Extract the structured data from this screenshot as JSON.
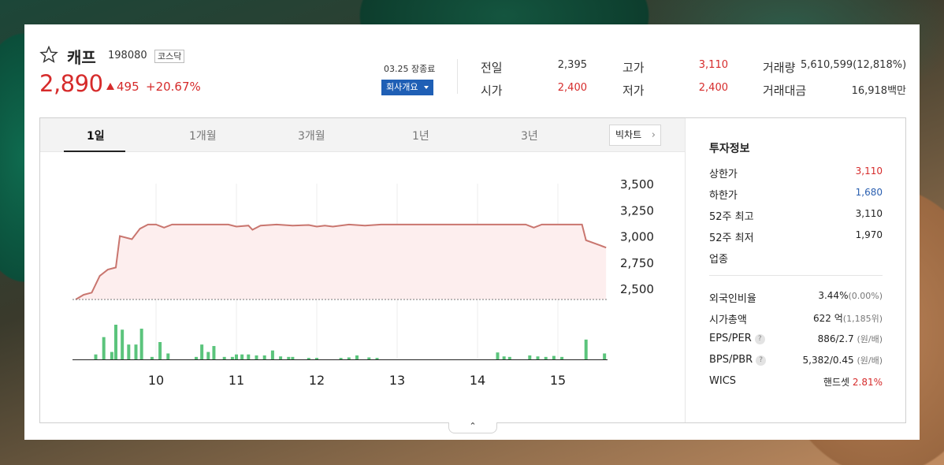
{
  "stock": {
    "name": "캐프",
    "code": "198080",
    "market": "코스닥",
    "price": "2,890",
    "change": "495",
    "change_rate": "+20.67%",
    "close_time": "03.25 장종료",
    "company_button": "회사개요"
  },
  "quotes": {
    "prev_close_label": "전일",
    "prev_close": "2,395",
    "open_label": "시가",
    "open": "2,400",
    "high_label": "고가",
    "high": "3,110",
    "low_label": "저가",
    "low": "2,400",
    "volume_label": "거래량",
    "volume": "5,610,599(12,818%)",
    "amount_label": "거래대금",
    "amount": "16,918백만"
  },
  "tabs": [
    "1일",
    "1개월",
    "3개월",
    "1년",
    "3년"
  ],
  "bigchart_label": "빅차트",
  "chart_data": {
    "type": "line",
    "y_ticks": [
      "3,500",
      "3,250",
      "3,000",
      "2,750",
      "2,500"
    ],
    "x_ticks": [
      "10",
      "11",
      "12",
      "13",
      "14",
      "15"
    ],
    "ylim": [
      2500,
      3500
    ],
    "reference_line": 2395,
    "price_series": [
      [
        9.0,
        2395
      ],
      [
        9.1,
        2440
      ],
      [
        9.2,
        2460
      ],
      [
        9.3,
        2620
      ],
      [
        9.4,
        2680
      ],
      [
        9.5,
        2700
      ],
      [
        9.55,
        3000
      ],
      [
        9.7,
        2970
      ],
      [
        9.8,
        3070
      ],
      [
        9.9,
        3110
      ],
      [
        10.0,
        3110
      ],
      [
        10.1,
        3080
      ],
      [
        10.2,
        3110
      ],
      [
        10.5,
        3110
      ],
      [
        10.9,
        3110
      ],
      [
        11.0,
        3090
      ],
      [
        11.15,
        3100
      ],
      [
        11.2,
        3060
      ],
      [
        11.3,
        3100
      ],
      [
        11.5,
        3110
      ],
      [
        11.7,
        3100
      ],
      [
        11.9,
        3105
      ],
      [
        12.0,
        3090
      ],
      [
        12.1,
        3100
      ],
      [
        12.2,
        3090
      ],
      [
        12.4,
        3110
      ],
      [
        12.6,
        3100
      ],
      [
        12.8,
        3110
      ],
      [
        13.5,
        3110
      ],
      [
        14.0,
        3110
      ],
      [
        14.6,
        3110
      ],
      [
        14.7,
        3080
      ],
      [
        14.8,
        3110
      ],
      [
        15.2,
        3110
      ],
      [
        15.3,
        3110
      ],
      [
        15.35,
        2960
      ],
      [
        15.6,
        2890
      ]
    ],
    "volume_series": [
      [
        9.25,
        0.1
      ],
      [
        9.35,
        0.45
      ],
      [
        9.45,
        0.15
      ],
      [
        9.5,
        0.7
      ],
      [
        9.58,
        0.6
      ],
      [
        9.66,
        0.3
      ],
      [
        9.75,
        0.3
      ],
      [
        9.82,
        0.62
      ],
      [
        9.95,
        0.05
      ],
      [
        10.05,
        0.35
      ],
      [
        10.15,
        0.12
      ],
      [
        10.5,
        0.05
      ],
      [
        10.57,
        0.3
      ],
      [
        10.65,
        0.15
      ],
      [
        10.72,
        0.27
      ],
      [
        10.85,
        0.05
      ],
      [
        10.95,
        0.05
      ],
      [
        11.0,
        0.1
      ],
      [
        11.07,
        0.1
      ],
      [
        11.15,
        0.1
      ],
      [
        11.25,
        0.08
      ],
      [
        11.35,
        0.08
      ],
      [
        11.45,
        0.18
      ],
      [
        11.55,
        0.06
      ],
      [
        11.65,
        0.05
      ],
      [
        11.7,
        0.05
      ],
      [
        11.9,
        0.03
      ],
      [
        12.0,
        0.03
      ],
      [
        12.3,
        0.03
      ],
      [
        12.4,
        0.04
      ],
      [
        12.5,
        0.08
      ],
      [
        12.65,
        0.04
      ],
      [
        12.75,
        0.03
      ],
      [
        14.25,
        0.14
      ],
      [
        14.33,
        0.06
      ],
      [
        14.4,
        0.05
      ],
      [
        14.65,
        0.08
      ],
      [
        14.75,
        0.06
      ],
      [
        14.85,
        0.05
      ],
      [
        14.95,
        0.07
      ],
      [
        15.05,
        0.05
      ],
      [
        15.35,
        0.4
      ],
      [
        15.58,
        0.12
      ]
    ]
  },
  "info": {
    "title": "투자정보",
    "upper_limit_label": "상한가",
    "upper_limit": "3,110",
    "lower_limit_label": "하한가",
    "lower_limit": "1,680",
    "high52_label": "52주 최고",
    "high52": "3,110",
    "low52_label": "52주 최저",
    "low52": "1,970",
    "sector_label": "업종",
    "foreign_label": "외국인비율",
    "foreign": "3.44%",
    "foreign_sub": "(0.00%)",
    "mcap_label": "시가총액",
    "mcap": "622 억",
    "mcap_sub": "(1,185위)",
    "eps_label": "EPS/PER",
    "eps": "886/2.7",
    "eps_sub": "(원/배)",
    "bps_label": "BPS/PBR",
    "bps": "5,382/0.45",
    "bps_sub": "(원/배)",
    "wics_label": "WICS",
    "wics": "핸드셋",
    "wics_rate": "2.81%"
  },
  "colors": {
    "up": "#d62b2b",
    "down": "#2a5fb0",
    "line": "#c9766f",
    "fill": "#fdeeee",
    "volume": "#5bc47c"
  }
}
